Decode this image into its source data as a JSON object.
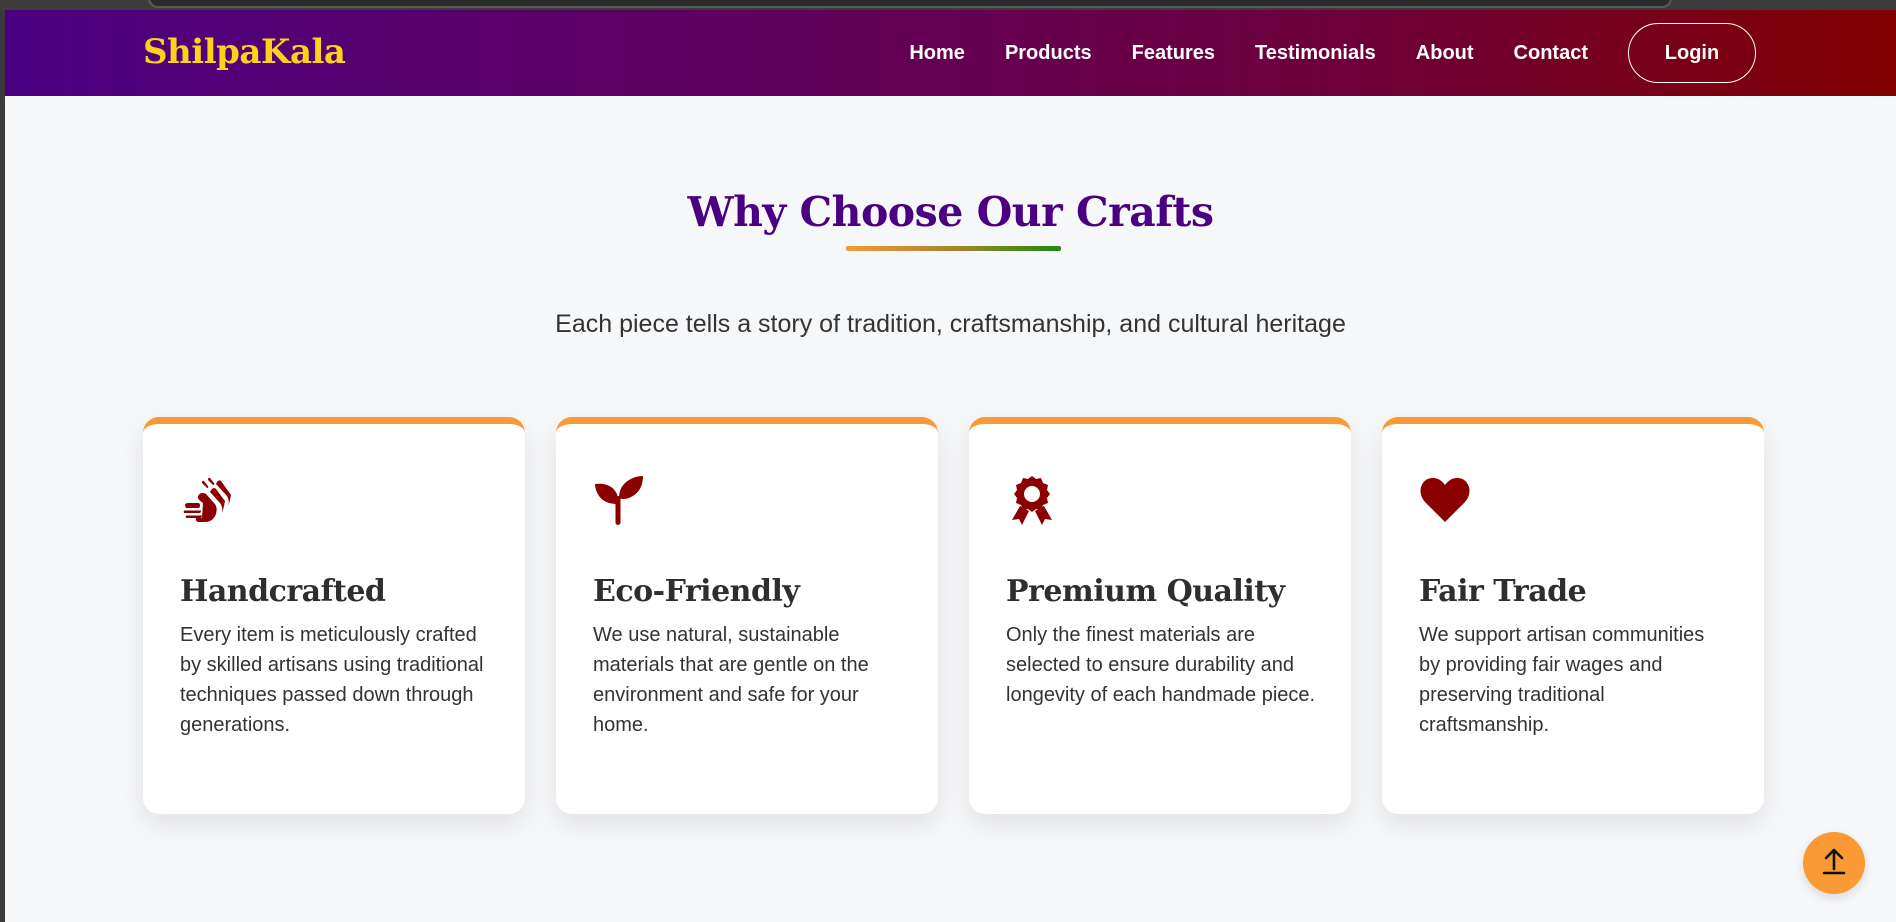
{
  "navbar": {
    "brand": "ShilpaKala",
    "links": [
      "Home",
      "Products",
      "Features",
      "Testimonials",
      "About",
      "Contact"
    ],
    "login_label": "Login"
  },
  "features_section": {
    "title": "Why Choose Our Crafts",
    "subtitle": "Each piece tells a story of tradition, craftsmanship, and cultural heritage",
    "cards": [
      {
        "icon": "hands-icon",
        "title": "Handcrafted",
        "description": "Every item is meticulously crafted by skilled artisans using traditional techniques passed down through generations."
      },
      {
        "icon": "seedling-icon",
        "title": "Eco-Friendly",
        "description": "We use natural, sustainable materials that are gentle on the environment and safe for your home."
      },
      {
        "icon": "award-icon",
        "title": "Premium Quality",
        "description": "Only the finest materials are selected to ensure durability and longevity of each handmade piece."
      },
      {
        "icon": "heart-icon",
        "title": "Fair Trade",
        "description": "We support artisan communities by providing fair wages and preserving traditional craftsmanship."
      }
    ]
  },
  "back_to_top": {
    "icon": "arrow-up-icon"
  },
  "colors": {
    "brand_yellow": "#ffd21a",
    "nav_gradient_start": "#4b0082",
    "nav_gradient_end": "#800000",
    "title_purple": "#4b0082",
    "icon_maroon": "#8b0000",
    "accent_orange": "#f79a35",
    "page_background": "#f6f7f9"
  }
}
